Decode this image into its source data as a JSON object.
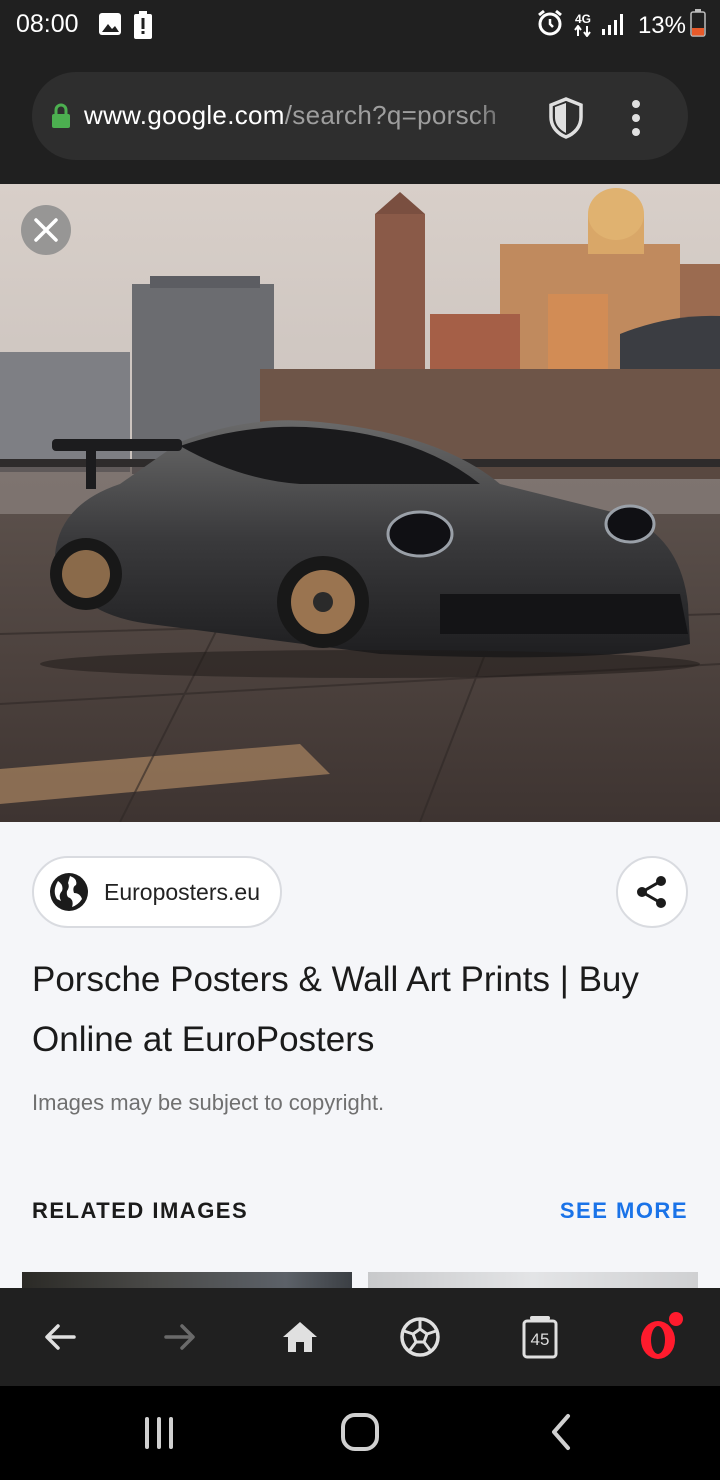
{
  "status_bar": {
    "time": "08:00",
    "network": "4G",
    "battery": "13%",
    "icons": [
      "image-icon",
      "battery-alert-icon",
      "alarm-icon",
      "network-4g-icon",
      "signal-icon",
      "battery-icon"
    ]
  },
  "browser": {
    "url_host": "www.google.com",
    "url_path": "/search?q=porsch",
    "icons": [
      "lock-icon",
      "shield-icon",
      "more-vert-icon"
    ]
  },
  "image_viewer": {
    "close_icon": "close-icon",
    "source_label": "Europosters.eu",
    "title": "Porsche Posters & Wall Art Prints | Buy Online at EuroPosters",
    "copyright_note": "Images may be subject to copyright.",
    "related_heading": "RELATED IMAGES",
    "see_more_label": "SEE MORE"
  },
  "bottom_nav": {
    "tab_count": "45",
    "icons": [
      "back-icon",
      "forward-icon",
      "home-icon",
      "football-icon",
      "tabs-icon",
      "opera-menu-icon"
    ]
  },
  "system_nav": {
    "icons": [
      "recents-icon",
      "home-button-icon",
      "back-button-icon"
    ]
  },
  "colors": {
    "status_bar_bg": "#202020",
    "url_pill_bg": "#2e2e2e",
    "lock_green": "#4caf50",
    "link_blue": "#1a73e8",
    "opera_red": "#ff1b2d",
    "page_bg": "#f5f6f9"
  }
}
